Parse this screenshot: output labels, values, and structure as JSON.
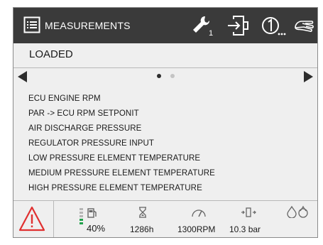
{
  "header": {
    "title": "MEASUREMENTS",
    "wrench_badge": "1"
  },
  "status": {
    "state": "LOADED"
  },
  "pager": {
    "total": 2,
    "active": 1
  },
  "measurements": [
    "ECU ENGINE RPM",
    "PAR -> ECU RPM SETPONIT",
    "AIR DISCHARGE PRESSURE",
    "REGULATOR PRESSURE INPUT",
    "LOW PRESSURE ELEMENT TEMPERATURE",
    "MEDIUM PRESSURE ELEMENT TEMPERATURE",
    "HIGH PRESSURE ELEMENT TEMPERATURE"
  ],
  "footer": {
    "load": "40%",
    "load_fraction": 0.4,
    "hours": "1286h",
    "rpm": "1300RPM",
    "pressure": "10.3 bar"
  },
  "icons": {
    "menu": "menu-icon",
    "service": "wrench-icon",
    "door": "door-enter-icon",
    "counter": "circle-one-icon",
    "hand": "hand-icon",
    "alarm": "warning-triangle-icon",
    "fuel": "fuel-pump-icon",
    "hourglass": "hourglass-icon",
    "gauge": "gauge-icon",
    "valve": "valve-icon",
    "drops": "water-drops-icon"
  },
  "colors": {
    "topbar": "#3a3a3a",
    "background": "#efefef",
    "alarm": "#e03030",
    "load_bar": "#21a14b",
    "bar_inactive": "#b5b5b5"
  }
}
